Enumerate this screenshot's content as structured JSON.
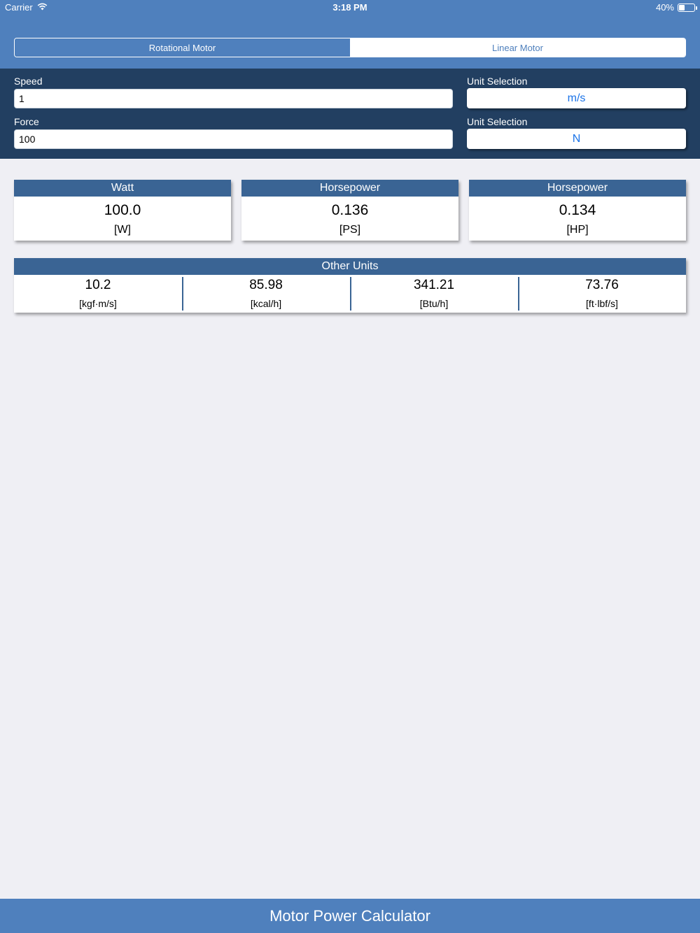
{
  "status_bar": {
    "carrier": "Carrier",
    "time": "3:18 PM",
    "battery": "40%",
    "battery_level": 0.4,
    "wifi_icon": "wifi-icon",
    "battery_icon": "battery-icon"
  },
  "segments": {
    "rotational": "Rotational Motor",
    "linear": "Linear Motor",
    "selected": "rotational"
  },
  "inputs": {
    "speed_label": "Speed",
    "speed_value": "1",
    "force_label": "Force",
    "force_value": "100",
    "unit_label_1": "Unit Selection",
    "unit_value_1": "m/s",
    "unit_label_2": "Unit Selection",
    "unit_value_2": "N"
  },
  "results": [
    {
      "title": "Watt",
      "value": "100.0",
      "unit": "[W]"
    },
    {
      "title": "Horsepower",
      "value": "0.136",
      "unit": "[PS]"
    },
    {
      "title": "Horsepower",
      "value": "0.134",
      "unit": "[HP]"
    }
  ],
  "other_units": {
    "title": "Other Units",
    "cells": [
      {
        "value": "10.2",
        "unit": "[kgf·m/s]"
      },
      {
        "value": "85.98",
        "unit": "[kcal/h]"
      },
      {
        "value": "341.21",
        "unit": "[Btu/h]"
      },
      {
        "value": "73.76",
        "unit": "[ft·lbf/s]"
      }
    ]
  },
  "footer": {
    "title": "Motor Power Calculator"
  },
  "colors": {
    "header": "#4f80bd",
    "panel": "#223f61",
    "card_header": "#3a6494",
    "background": "#efeff4",
    "link_blue": "#1a73e8"
  }
}
